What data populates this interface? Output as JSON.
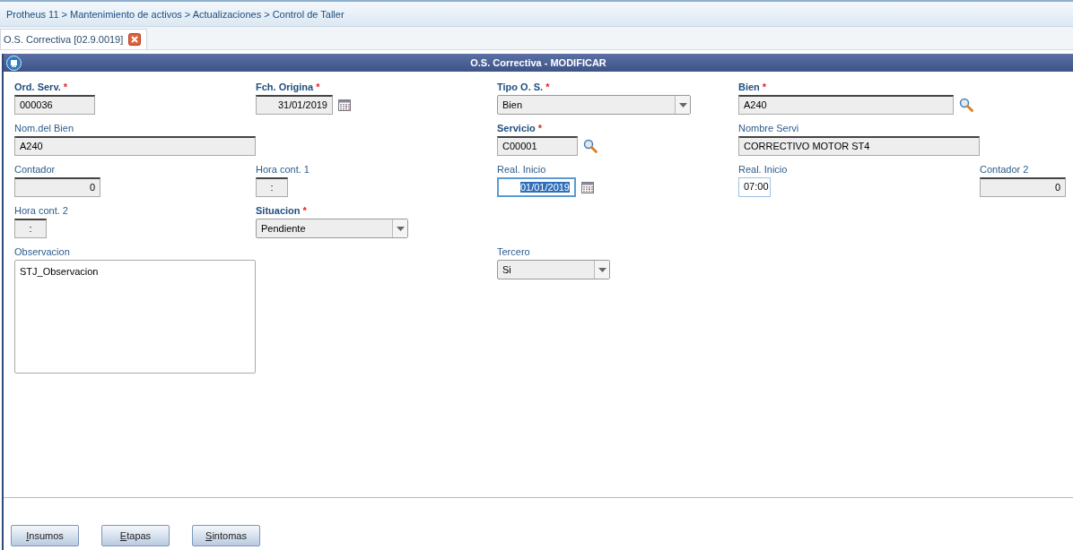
{
  "breadcrumb": "Protheus 11 > Mantenimiento de activos > Actualizaciones > Control de Taller",
  "tabs": [
    {
      "label": "O.S. Correctiva [02.9.0019]",
      "selected": true
    }
  ],
  "dialog": {
    "title": "O.S. Correctiva - MODIFICAR"
  },
  "rows": [
    [
      {
        "label": "Ord. Serv.",
        "mark": "*",
        "kind": "text",
        "value": "000036"
      },
      {
        "label": "Fch. Origina",
        "mark": "*",
        "kind": "date",
        "value": "31/01/2019",
        "focused": false
      },
      {
        "label": "Tipo O. S.",
        "mark": "*",
        "kind": "select",
        "value": "Bien"
      },
      {
        "label": "Bien",
        "mark": "*",
        "kind": "lookup",
        "value": "A240"
      },
      null
    ],
    [
      {
        "label": "Nom.del Bien",
        "kind": "text",
        "value": "A240"
      },
      null,
      {
        "label": "Servicio",
        "mark": "*",
        "kind": "lookup",
        "value": "C00001"
      },
      {
        "label": "Nombre Servi",
        "kind": "text",
        "value": "CORRECTIVO MOTOR ST4"
      },
      null
    ],
    [
      {
        "label": "Contador",
        "kind": "number",
        "value": "0"
      },
      {
        "label": "Hora cont. 1",
        "kind": "hour",
        "value": ":",
        "editable": false
      },
      {
        "label": "Real. Inicio",
        "kind": "date",
        "value": "01/01/2019",
        "focused": true
      },
      {
        "label": "Real. Inicio",
        "kind": "hour",
        "value": "07:00",
        "editable": true
      },
      {
        "label": "Contador 2",
        "kind": "number",
        "value": "0"
      }
    ],
    [
      {
        "label": "Hora cont. 2",
        "kind": "hour",
        "value": ":",
        "editable": false
      },
      {
        "label": "Situacion",
        "mark": "*",
        "kind": "select",
        "value": "Pendiente"
      },
      null,
      null,
      null
    ],
    [
      {
        "label": "Observacion",
        "kind": "memo",
        "value": "STJ_Observacion"
      },
      null,
      {
        "label": "Tercero",
        "kind": "select",
        "value": "Si"
      },
      null,
      null
    ]
  ],
  "buttons": [
    "Insumos",
    "Etapas",
    "Sintomas"
  ]
}
